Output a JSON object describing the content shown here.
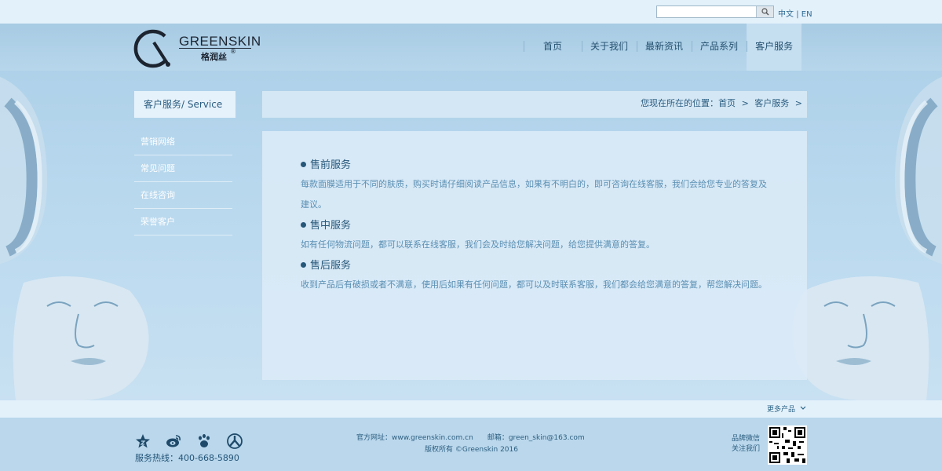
{
  "lang": {
    "zh": "中文",
    "sep": "|",
    "en": "EN"
  },
  "logo": {
    "brand_en": "GREENSKIN",
    "brand_cn": "格润丝",
    "reg": "®"
  },
  "nav": [
    "首页",
    "关于我们",
    "最新资讯",
    "产品系列",
    "客户服务"
  ],
  "nav_active_index": 4,
  "sidebar": {
    "title": "客户服务/ Service",
    "items": [
      "营销网络",
      "常见问题",
      "在线咨询",
      "荣誉客户"
    ]
  },
  "breadcrumb": {
    "prefix": "您现在所在的位置：",
    "home": "首页",
    "sep1": ">",
    "current": "客户服务",
    "sep2": ">"
  },
  "sections": [
    {
      "title": "售前服务",
      "text": "每款面膜适用于不同的肤质，购买时请仔细阅读产品信息，如果有不明白的，即可咨询在线客服，我们会给您专业的答复及建议。"
    },
    {
      "title": "售中服务",
      "text": "如有任何物流问题，都可以联系在线客服，我们会及时给您解决问题，给您提供满意的答复。"
    },
    {
      "title": "售后服务",
      "text": "收到产品后有破损或者不满意，使用后如果有任何问题，都可以及时联系客服，我们都会给您满意的答复，帮您解决问题。"
    }
  ],
  "more": "更多产品",
  "footer": {
    "hotline": "服务热线：400-668-5890",
    "website": "官方网址：www.greenskin.com.cn",
    "email": "邮箱：green_skin@163.com",
    "copyright": "版权所有 ©Greenskin 2016",
    "wechat_line1": "品牌微信",
    "wechat_line2": "关注我们"
  },
  "colors": {
    "accent": "#23506f",
    "text_light": "#5a8fb3",
    "panel": "#e6f2fb"
  },
  "icons": [
    "search-icon",
    "star-icon",
    "weibo-icon",
    "paw-icon",
    "renren-icon",
    "chevron-down-icon",
    "qr-code"
  ]
}
